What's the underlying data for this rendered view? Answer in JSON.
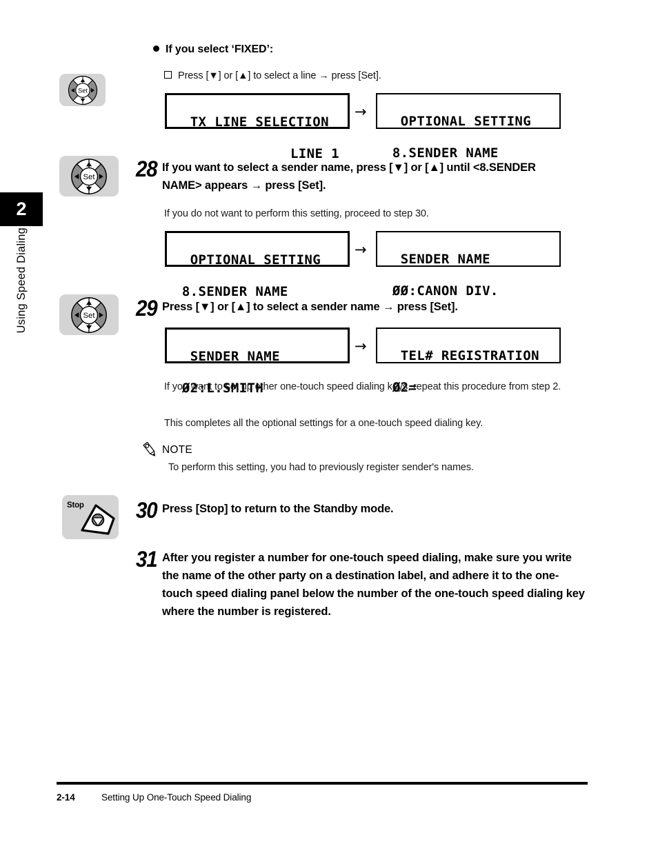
{
  "sidebar": {
    "chapter_number": "2",
    "chapter_title": "Using Speed Dialing"
  },
  "intro": {
    "bullet_heading": "If you select ‘FIXED’:",
    "sub_bullet": "Press [▼] or [▲] to select a line → press [Set].",
    "lcd_left_line1": "TX LINE SELECTION",
    "lcd_left_line2": "LINE 1",
    "arrow": "→",
    "lcd_right_line1": "OPTIONAL SETTING",
    "lcd_right_line2": " 8.SENDER NAME"
  },
  "steps": [
    {
      "number": "28",
      "heading": "If you want to select a sender name, press [▼] or [▲] until <8.SENDER NAME> appears → press [Set].",
      "note": "If you do not want to perform this setting, proceed to step 30.",
      "lcd_left_line1": "OPTIONAL SETTING",
      "lcd_left_line2": " 8.SENDER NAME",
      "arrow": "→",
      "lcd_right_line1": "SENDER NAME",
      "lcd_right_line2": " ØØ:CANON DIV.",
      "icon": "nav-wheel-set-icon"
    },
    {
      "number": "29",
      "heading": "Press [▼] or [▲] to select a sender name → press [Set].",
      "after_1": "If you want to set up other one-touch speed dialing keys, repeat this procedure from step 2.",
      "after_2": "This completes all the optional settings for a one-touch speed dialing key.",
      "lcd_left_line1": "SENDER NAME",
      "lcd_left_line2": " Ø2:L.SMITH",
      "arrow": "→",
      "lcd_right_line1": "TEL# REGISTRATION",
      "lcd_right_line2": " Ø2=",
      "icon": "nav-wheel-set-icon"
    },
    {
      "number": "30",
      "heading": "Press [Stop] to return to the Standby mode.",
      "icon": "stop-key-icon"
    },
    {
      "number": "31",
      "heading": "After you register a number for one-touch speed dialing, make sure you write the name of the other party on a destination label, and adhere it to the one-touch speed dialing panel below the number of the one-touch speed dialing key where the number is registered."
    }
  ],
  "note_block": {
    "title": "NOTE",
    "body": "To perform this setting, you had to previously register sender's names.",
    "icon": "pencil-icon"
  },
  "keys": {
    "set_label": "Set",
    "stop_label": "Stop"
  },
  "footer": {
    "page_number": "2-14",
    "section_title": "Setting Up One-Touch Speed Dialing"
  },
  "colors": {
    "chip_gray": "#d4d4d4",
    "wheel_gray": "#8c8c8c",
    "ink": "#000000"
  }
}
